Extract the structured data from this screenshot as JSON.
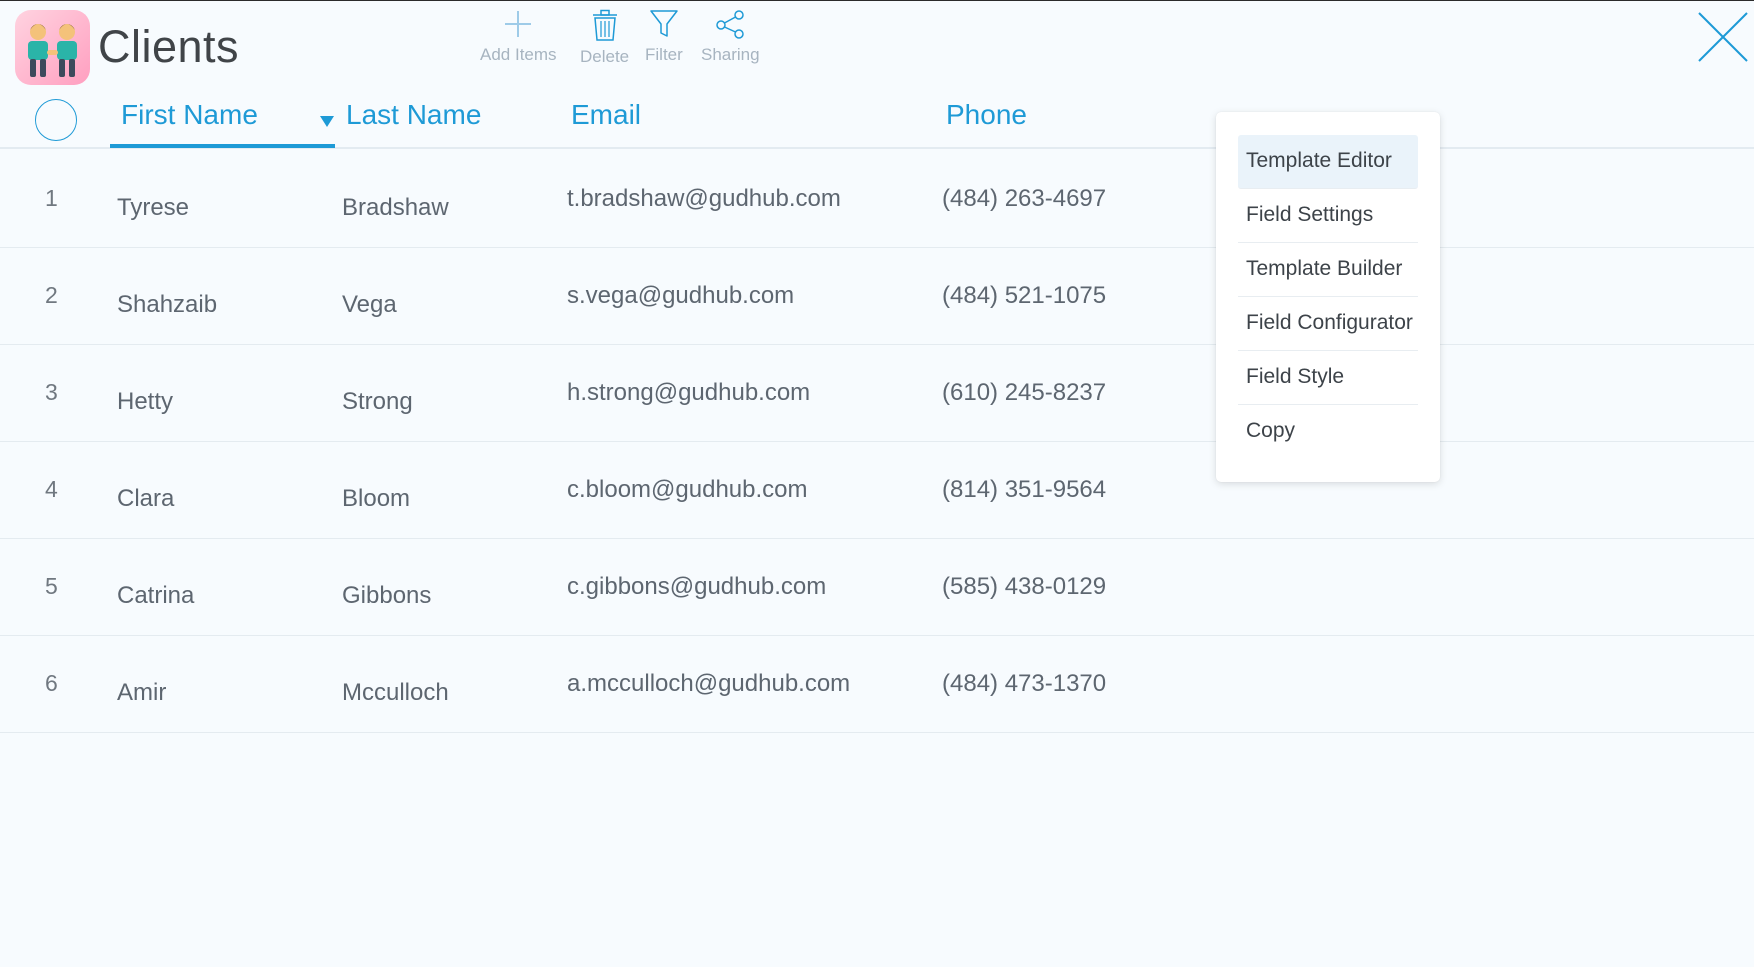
{
  "app": {
    "title": "Clients",
    "icon": "people-holding-hands-icon"
  },
  "toolbar": {
    "add_label": "Add Items",
    "delete_label": "Delete",
    "filter_label": "Filter",
    "sharing_label": "Sharing"
  },
  "colors": {
    "accent": "#1e9ad6",
    "toolbar_label": "#a7b4c0",
    "text": "#5d6670",
    "background": "#f7fbfe"
  },
  "table": {
    "columns": [
      "First Name",
      "Last Name",
      "Email",
      "Phone"
    ],
    "sorted_column": "First Name",
    "rows": [
      {
        "num": "1",
        "first": "Tyrese",
        "last": "Bradshaw",
        "email": "t.bradshaw@gudhub.com",
        "phone": "(484) 263-4697"
      },
      {
        "num": "2",
        "first": "Shahzaib",
        "last": "Vega",
        "email": "s.vega@gudhub.com",
        "phone": "(484) 521-1075"
      },
      {
        "num": "3",
        "first": "Hetty",
        "last": "Strong",
        "email": "h.strong@gudhub.com",
        "phone": "(610) 245-8237"
      },
      {
        "num": "4",
        "first": "Clara",
        "last": "Bloom",
        "email": "c.bloom@gudhub.com",
        "phone": "(814) 351-9564"
      },
      {
        "num": "5",
        "first": "Catrina",
        "last": "Gibbons",
        "email": "c.gibbons@gudhub.com",
        "phone": "(585) 438-0129"
      },
      {
        "num": "6",
        "first": "Amir",
        "last": "Mcculloch",
        "email": "a.mcculloch@gudhub.com",
        "phone": "(484) 473-1370"
      }
    ]
  },
  "context_menu": {
    "items": [
      "Template Editor",
      "Field Settings",
      "Template Builder",
      "Field Configurator",
      "Field Style",
      "Copy"
    ],
    "active": "Template Editor"
  }
}
